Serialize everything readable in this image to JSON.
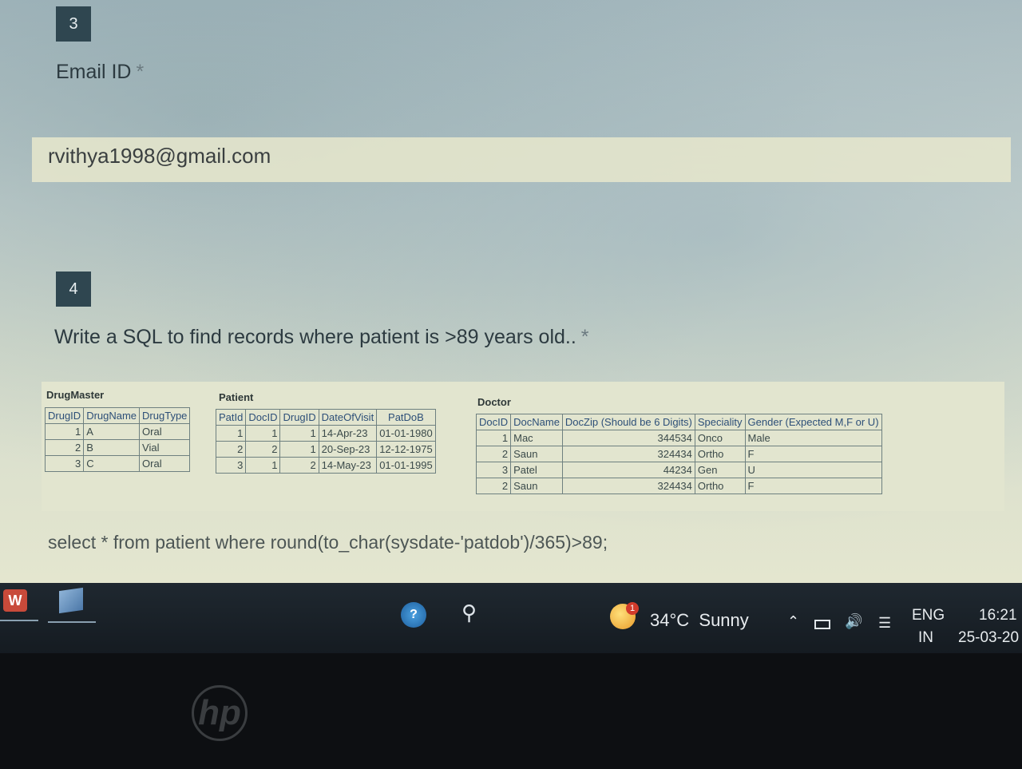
{
  "questions": [
    {
      "number": "3",
      "label": "Email ID",
      "required_mark": "*",
      "answer": "rvithya1998@gmail.com"
    },
    {
      "number": "4",
      "label": "Write a SQL to find records where patient is >89 years old..",
      "required_mark": "*",
      "answer": "select * from patient where round(to_char(sysdate-'patdob')/365)>89;"
    }
  ],
  "sheet": {
    "drug_master": {
      "title": "DrugMaster",
      "headers": [
        "DrugID",
        "DrugName",
        "DrugType"
      ],
      "rows": [
        [
          "1",
          "A",
          "Oral"
        ],
        [
          "2",
          "B",
          "Vial"
        ],
        [
          "3",
          "C",
          "Oral"
        ]
      ]
    },
    "patient": {
      "title": "Patient",
      "headers": [
        "PatId",
        "DocID",
        "DrugID",
        "DateOfVisit",
        "PatDoB"
      ],
      "rows": [
        [
          "1",
          "1",
          "1",
          "14-Apr-23",
          "01-01-1980"
        ],
        [
          "2",
          "2",
          "1",
          "20-Sep-23",
          "12-12-1975"
        ],
        [
          "3",
          "1",
          "2",
          "14-May-23",
          "01-01-1995"
        ]
      ]
    },
    "doctor": {
      "title": "Doctor",
      "headers": [
        "DocID",
        "DocName",
        "DocZip (Should be 6 Digits)",
        "Speciality",
        "Gender (Expected M,F or U)"
      ],
      "rows": [
        [
          "1",
          "Mac",
          "344534",
          "Onco",
          "Male"
        ],
        [
          "2",
          "Saun",
          "324434",
          "Ortho",
          "F"
        ],
        [
          "3",
          "Patel",
          "44234",
          "Gen",
          "U"
        ],
        [
          "2",
          "Saun",
          "324434",
          "Ortho",
          "F"
        ]
      ]
    }
  },
  "taskbar": {
    "start_badge": "W",
    "weather_badge": "1",
    "temperature": "34°C",
    "condition": "Sunny",
    "language_top": "ENG",
    "language_bottom": "IN",
    "time": "16:21",
    "date": "25-03-20"
  },
  "bezel": {
    "logo": "hp"
  },
  "colors": {
    "question_badge": "#2f4650",
    "taskbar": "#1a2128",
    "answer_box": "#e8e8cd"
  }
}
